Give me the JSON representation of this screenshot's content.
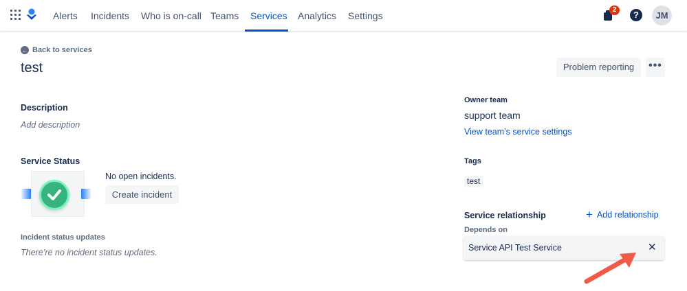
{
  "nav": {
    "items": [
      "Alerts",
      "Incidents",
      "Who is on-call",
      "Teams",
      "Services",
      "Analytics",
      "Settings"
    ],
    "active": "Services",
    "notification_count": "2",
    "help_glyph": "?",
    "avatar_initials": "JM",
    "accent_color": "#0052cc"
  },
  "header": {
    "back_label": "Back to services",
    "title": "test",
    "problem_reporting_label": "Problem reporting",
    "more_label": "•••"
  },
  "description": {
    "title": "Description",
    "placeholder": "Add description"
  },
  "service_status": {
    "title": "Service Status",
    "message": "No open incidents.",
    "create_incident_label": "Create incident",
    "status_color": "#36b37e"
  },
  "incident_updates": {
    "title": "Incident status updates",
    "empty_message": "There’re no incident status updates."
  },
  "owner": {
    "label": "Owner team",
    "team_name": "support team",
    "settings_link": "View team’s service settings"
  },
  "tags": {
    "label": "Tags",
    "items": [
      "test"
    ]
  },
  "relationship": {
    "title": "Service relationship",
    "add_label": "Add relationship",
    "depends_label": "Depends on",
    "depends_on": [
      "Service API Test Service"
    ],
    "remove_glyph": "✕",
    "annotation_arrow_color": "#f05a47"
  }
}
